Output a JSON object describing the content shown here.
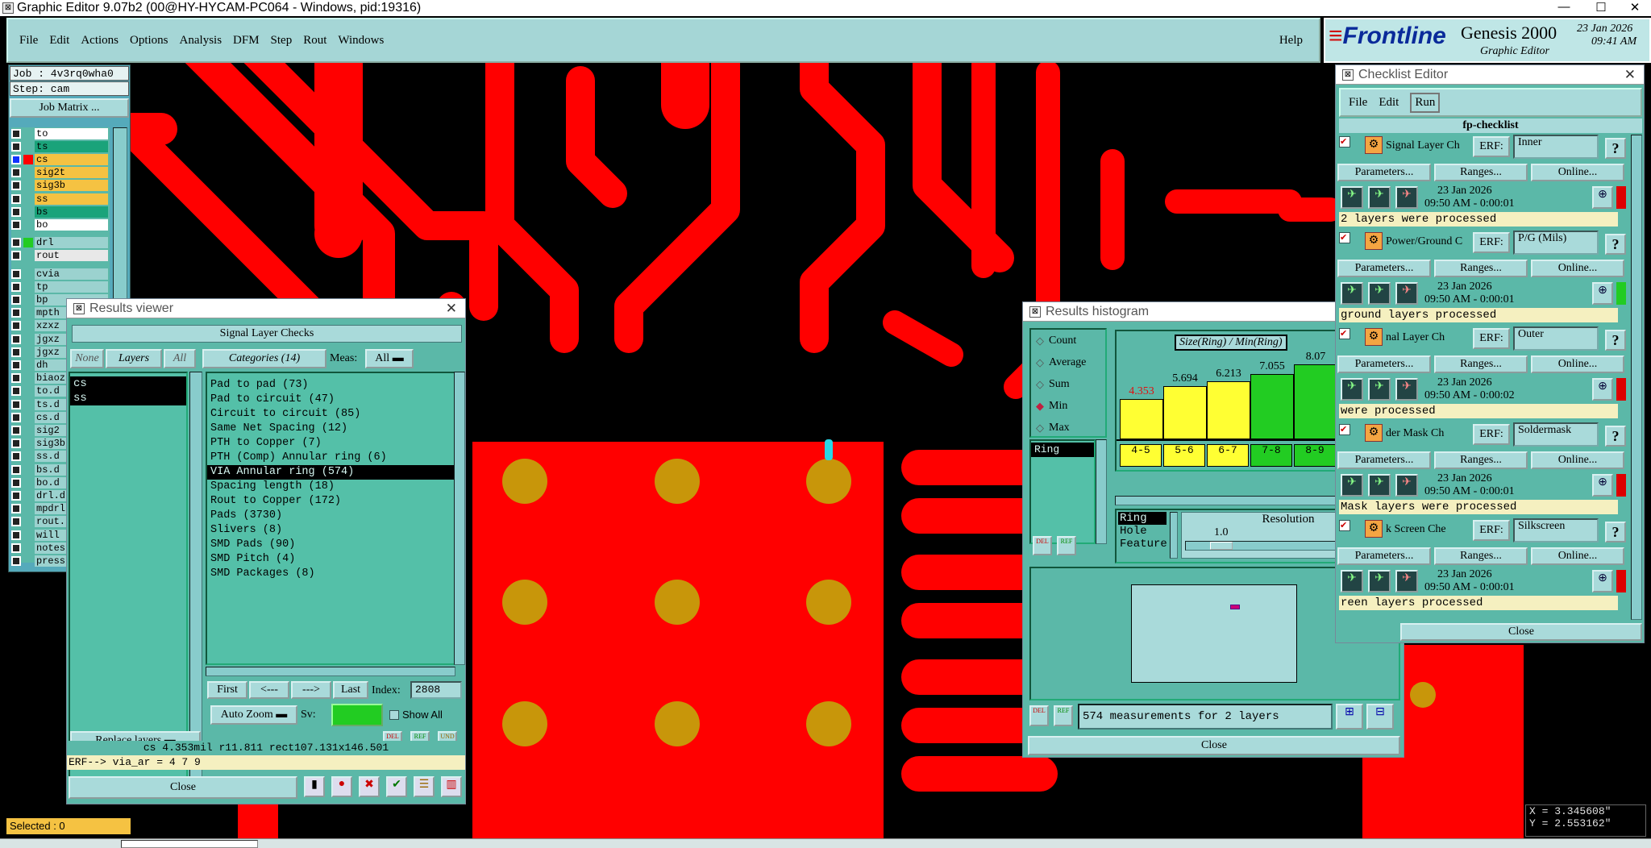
{
  "app": {
    "title": "Graphic Editor 9.07b2 (00@HY-HYCAM-PC064 - Windows, pid:19316)"
  },
  "menu": [
    "File",
    "Edit",
    "Actions",
    "Options",
    "Analysis",
    "DFM",
    "Step",
    "Rout",
    "Windows"
  ],
  "help": "Help",
  "brand": {
    "logo": "Frontline",
    "product": "Genesis 2000",
    "subtitle": "Graphic Editor",
    "date": "23 Jan 2026",
    "time": "09:41 AM"
  },
  "job": {
    "job": "Job : 4v3rq0wha0",
    "step": "Step: cam",
    "matrix_btn": "Job Matrix ..."
  },
  "layers": [
    {
      "name": "to",
      "color": "#ffffff"
    },
    {
      "name": "ts",
      "color": "#1aa37a"
    },
    {
      "name": "cs",
      "color": "#f5c242"
    },
    {
      "name": "sig2t",
      "color": "#f5c242"
    },
    {
      "name": "sig3b",
      "color": "#f5c242"
    },
    {
      "name": "ss",
      "color": "#f5c242"
    },
    {
      "name": "bs",
      "color": "#1aa37a"
    },
    {
      "name": "bo",
      "color": "#ffffff"
    },
    {
      "name": "drl",
      "color": "#9bd2cf"
    },
    {
      "name": "rout",
      "color": "#e8e8e8"
    },
    {
      "name": "cvia",
      "color": "#9bd2cf"
    },
    {
      "name": "tp",
      "color": "#9bd2cf"
    },
    {
      "name": "bp",
      "color": "#9bd2cf"
    },
    {
      "name": "mpth",
      "color": "#9bd2cf"
    },
    {
      "name": "xzxz",
      "color": "#9bd2cf"
    },
    {
      "name": "jgxz",
      "color": "#9bd2cf"
    },
    {
      "name": "jgxz",
      "color": "#9bd2cf"
    },
    {
      "name": "dh",
      "color": "#9bd2cf"
    },
    {
      "name": "biaoz",
      "color": "#9bd2cf"
    },
    {
      "name": "to.d",
      "color": "#9bd2cf"
    },
    {
      "name": "ts.d",
      "color": "#9bd2cf"
    },
    {
      "name": "cs.d",
      "color": "#9bd2cf"
    },
    {
      "name": "sig2",
      "color": "#9bd2cf"
    },
    {
      "name": "sig3b",
      "color": "#9bd2cf"
    },
    {
      "name": "ss.d",
      "color": "#9bd2cf"
    },
    {
      "name": "bs.d",
      "color": "#9bd2cf"
    },
    {
      "name": "bo.d",
      "color": "#9bd2cf"
    },
    {
      "name": "drl.d",
      "color": "#9bd2cf"
    },
    {
      "name": "mpdrl",
      "color": "#9bd2cf"
    },
    {
      "name": "rout.",
      "color": "#9bd2cf"
    },
    {
      "name": "will",
      "color": "#9bd2cf"
    },
    {
      "name": "notes",
      "color": "#9bd2cf"
    },
    {
      "name": "press",
      "color": "#9bd2cf"
    }
  ],
  "selected": "Selected : 0",
  "rv": {
    "title": "Results viewer",
    "header": "Signal Layer Checks",
    "none": "None",
    "layers": "Layers",
    "all": "All",
    "categories_btn": "Categories (14)",
    "meas_label": "Meas:",
    "meas_value": "All",
    "layer_items": [
      "cs",
      "ss"
    ],
    "categories": [
      "Pad to pad (73)",
      "Pad to circuit (47)",
      "Circuit to circuit (85)",
      "Same Net Spacing (12)",
      "PTH to Copper (7)",
      "PTH (Comp) Annular ring (6)",
      "VIA Annular ring (574)",
      "Spacing length (18)",
      "Rout to Copper (172)",
      "Pads (3730)",
      "Slivers (8)",
      "SMD Pads (90)",
      "SMD Pitch (4)",
      "SMD Packages (8)"
    ],
    "first": "First",
    "prev": "<---",
    "next": "--->",
    "last": "Last",
    "index_label": "Index:",
    "index_value": "2808",
    "auto_zoom": "Auto Zoom",
    "sv_label": "Sv:",
    "show_all": "Show All",
    "replace": "Replace layers",
    "status": "cs 4.353mil  r11.811  rect107.131x146.501",
    "erf": "ERF--> via_ar = 4 7 9",
    "close": "Close",
    "del": "DEL",
    "ref": "REF",
    "und": "UND"
  },
  "hist": {
    "title": "Results histogram",
    "modes": [
      "Count",
      "Average",
      "Sum",
      "Min",
      "Max"
    ],
    "selected_mode": "Min",
    "chart_title": "Size(Ring) / Min(Ring)",
    "list_item": "Ring",
    "feature_opts": [
      "Ring",
      "Hole",
      "Feature"
    ],
    "resolution_label": "Resolution",
    "resolution_value": "1.0",
    "summary": "574 measurements for 2 layers",
    "close": "Close"
  },
  "chart_data": {
    "type": "bar",
    "title": "Size(Ring) / Min(Ring)",
    "categories": [
      "4-5",
      "5-6",
      "6-7",
      "7-8",
      "8-9"
    ],
    "values": [
      4.353,
      5.694,
      6.213,
      7.055,
      8.07
    ],
    "value_labels": [
      "4.353",
      "5.694",
      "6.213",
      "7.055",
      "8.07"
    ],
    "bar_colors": [
      "#ffff33",
      "#ffff33",
      "#ffff33",
      "#22cc22",
      "#22cc22"
    ],
    "ylim": [
      0,
      8.5
    ],
    "grid": false
  },
  "cl": {
    "title": "Checklist Editor",
    "menu": [
      "File",
      "Edit",
      "Run"
    ],
    "name": "fp-checklist",
    "checks": [
      {
        "name": "Signal Layer Ch",
        "erf": "Inner",
        "date": "23 Jan 2026",
        "time": "09:50 AM - 0:00:01",
        "result": "2 layers were processed"
      },
      {
        "name": "Power/Ground C",
        "erf": "P/G (Mils)",
        "date": "23 Jan 2026",
        "time": "09:50 AM - 0:00:01",
        "result": "ground layers processed"
      },
      {
        "name": "nal Layer Ch",
        "erf": "Outer",
        "date": "23 Jan 2026",
        "time": "09:50 AM - 0:00:02",
        "result": "were processed"
      },
      {
        "name": "der Mask Ch",
        "erf": "Soldermask",
        "date": "23 Jan 2026",
        "time": "09:50 AM - 0:00:01",
        "result": "Mask layers were processed"
      },
      {
        "name": "k Screen Che",
        "erf": "Silkscreen",
        "date": "23 Jan 2026",
        "time": "09:50 AM - 0:00:01",
        "result": "reen layers processed"
      }
    ],
    "erf_label": "ERF:",
    "params": "Parameters...",
    "ranges": "Ranges...",
    "online": "Online...",
    "close": "Close"
  },
  "coords": {
    "x": "X = 3.345608\"",
    "y": "Y = 2.553162\""
  },
  "colors": {
    "copper": "#ff0000",
    "pad": "#c8960a",
    "panel": "#5bb8a8",
    "button": "#a9dada"
  }
}
